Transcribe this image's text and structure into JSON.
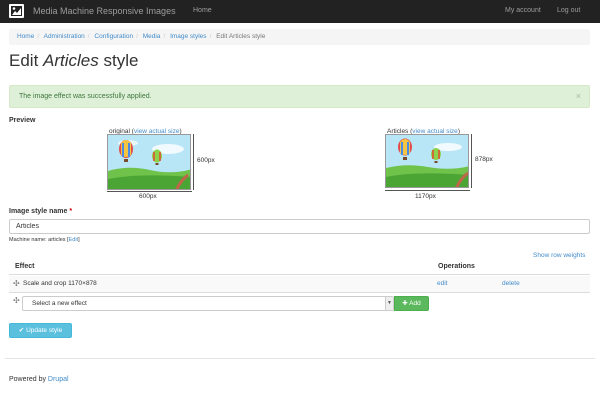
{
  "navbar": {
    "brand": "Media Machine Responsive Images",
    "home": "Home",
    "my_account": "My account",
    "logout": "Log out"
  },
  "breadcrumb": [
    "Home",
    "Administration",
    "Configuration",
    "Media",
    "Image styles",
    "Edit Articles style"
  ],
  "page": {
    "title_prefix": "Edit ",
    "title_em": "Articles",
    "title_suffix": " style"
  },
  "alert": {
    "message": "The image effect was successfully applied.",
    "close": "×"
  },
  "preview": {
    "label": "Preview",
    "original": {
      "caption": "original (",
      "link": "view actual size",
      "close": ")",
      "width_label": "600px",
      "height_label": "600px"
    },
    "styled": {
      "caption": "Articles (",
      "link": "view actual size",
      "close": ")",
      "width_label": "1170px",
      "height_label": "878px"
    }
  },
  "form": {
    "name_label": "Image style name",
    "required_mark": "*",
    "name_value": "Articles",
    "machine_prefix": "Machine name: articles [",
    "machine_edit": "Edit",
    "machine_suffix": "]"
  },
  "table": {
    "row_weights": "Show row weights",
    "col_effect": "Effect",
    "col_operations": "Operations",
    "rows": [
      {
        "effect": "Scale and crop 1170×878",
        "edit": "edit",
        "delete": "delete"
      }
    ],
    "new_effect_placeholder": "Select a new effect",
    "add_button": "Add"
  },
  "actions": {
    "update": "Update style"
  },
  "footer": {
    "text": "Powered by ",
    "link": "Drupal"
  },
  "colors": {
    "navbar": "#222222",
    "link": "#428bca",
    "alert_bg": "#dff0d8",
    "add_button": "#5cb85c",
    "update_button": "#5bc0de"
  }
}
